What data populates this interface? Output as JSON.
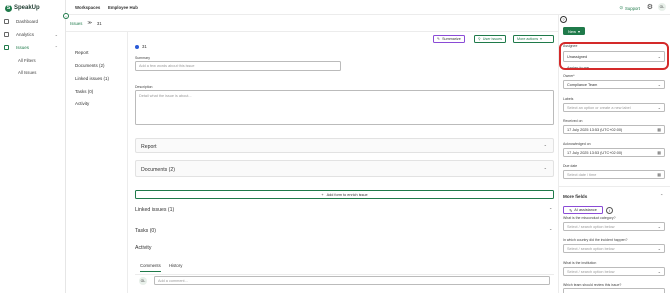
{
  "app": {
    "logo_text": "SpeakUp"
  },
  "sidebar": {
    "items": [
      {
        "label": "Dashboard"
      },
      {
        "label": "Analytics"
      },
      {
        "label": "Issues"
      }
    ],
    "sub_items": [
      {
        "label": "All Filters"
      },
      {
        "label": "All Issues"
      }
    ]
  },
  "topbar": {
    "tabs": [
      {
        "label": "Workspaces"
      },
      {
        "label": "Employee Hub"
      }
    ],
    "support_label": "Support",
    "avatar_initials": "GL"
  },
  "breadcrumb": {
    "root": "Issues",
    "sep": "≫",
    "current": "31"
  },
  "section_nav": [
    "Report",
    "Documents (2)",
    "Linked issues (1)",
    "Tasks (0)",
    "Activity"
  ],
  "actions": {
    "summarize": "Summarize",
    "user_issues": "User issues",
    "more_actions": "More actions"
  },
  "issue": {
    "id": "31",
    "summary_label": "Summary",
    "summary_placeholder": "Add a few words about this issue",
    "description_label": "Description",
    "description_placeholder": "Detail what the issue is about..."
  },
  "panels": {
    "report": "Report",
    "documents": "Documents (2)",
    "add_form": "Add form to enrich issue",
    "linked_issues": "Linked issues (1)",
    "tasks": "Tasks (0)",
    "activity": "Activity"
  },
  "activity_tabs": [
    "Comments",
    "History"
  ],
  "comment": {
    "avatar": "GL",
    "placeholder": "Add a comment..."
  },
  "right_panel": {
    "new_label": "New",
    "assignee_label": "Assignee",
    "assignee_value": "Unassigned",
    "assign_to_me": "Assign to me",
    "owner_label": "Owner*",
    "owner_value": "Compliance Team",
    "labels_label": "Labels",
    "labels_placeholder": "Select an option or create a new label",
    "received_label": "Received on",
    "received_value": "17 July 2025 13:53 (UTC+02:00)",
    "acknowledged_label": "Acknowledged on",
    "acknowledged_value": "17 July 2025 13:53 (UTC+02:00)",
    "due_label": "Due date",
    "due_placeholder": "Select date / time",
    "more_fields": "More fields",
    "ai_assistance": "AI assistance",
    "q1": "What is the misconduct category?",
    "q2": "In which country did the incident happen?",
    "q3": "What is the institution",
    "q4": "Which team should review this issue?",
    "select_placeholder": "Select / search option below"
  },
  "colors": {
    "accent": "#1f7a4a",
    "highlight": "#d42a2a",
    "ai": "#8a4bd6"
  }
}
